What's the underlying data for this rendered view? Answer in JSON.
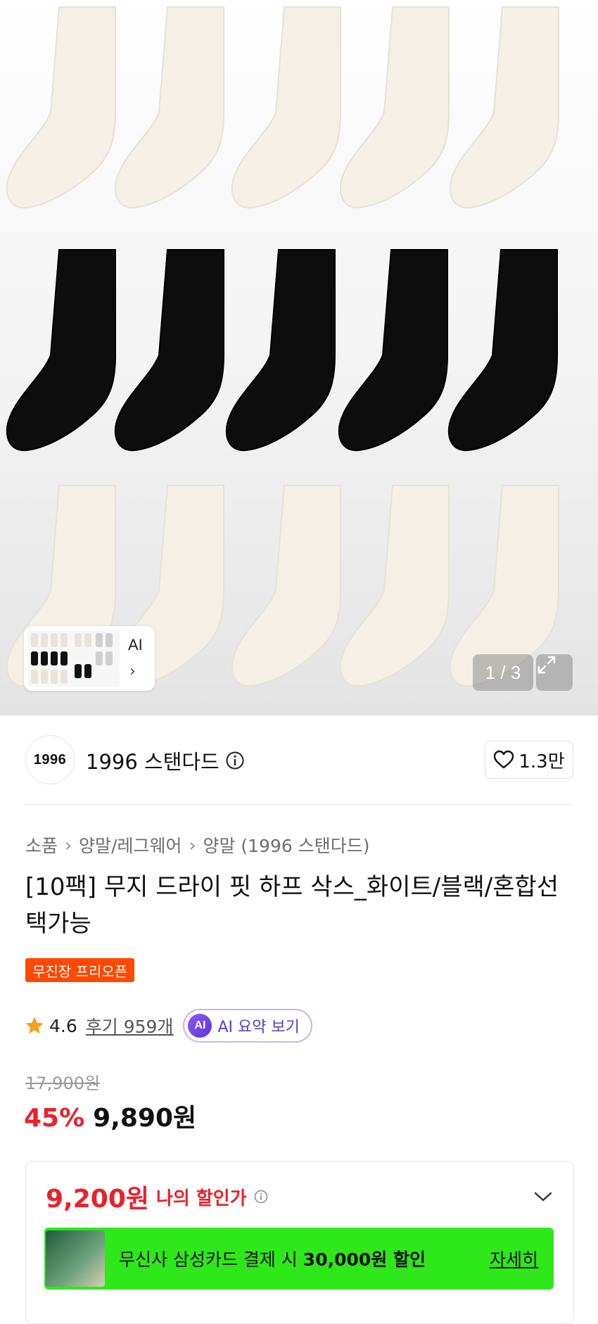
{
  "gallery": {
    "counter": "1 / 3",
    "ai_thumb_label": "AI",
    "ai_thumb_chevron": "›"
  },
  "brand": {
    "logo_text": "1996",
    "name": "1996 스탠다드",
    "like_count": "1.3만"
  },
  "breadcrumb": [
    "소품",
    "양말/레그웨어",
    "양말 (1996 스탠다드)"
  ],
  "product": {
    "title": "[10팩] 무지 드라이 핏 하프 삭스_화이트/블랙/혼합선택가능",
    "badge": "무진장 프리오픈",
    "rating": "4.6",
    "reviews": "후기 959개",
    "ai_summary_icon": "AI",
    "ai_summary_label": "AI 요약 보기",
    "original_price": "17,900원",
    "discount_rate": "45%",
    "price": "9,890원"
  },
  "discount": {
    "my_price_amount": "9,200원",
    "my_price_label": "나의 할인가",
    "card_text_prefix": "무신사 삼성카드 결제 시 ",
    "card_text_amount": "30,000원 할인",
    "card_more": "자세히"
  },
  "colors": {
    "accent_red": "#e8222b",
    "badge_orange": "#ff4800",
    "banner_green": "#2ee81a",
    "ai_purple": "#5b3fc7"
  }
}
